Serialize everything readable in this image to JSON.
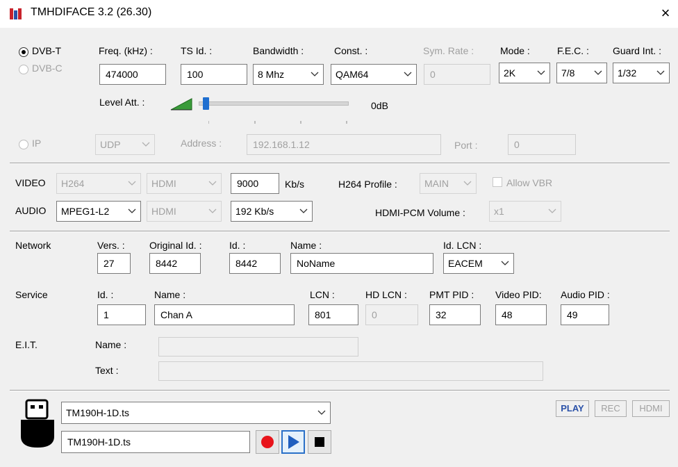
{
  "window": {
    "title": "TMHDIFACE 3.2 (26.30)",
    "close": "×"
  },
  "modulation": {
    "dvbt": "DVB-T",
    "dvbc": "DVB-C",
    "freq_label": "Freq. (kHz) :",
    "freq_value": "474000",
    "tsid_label": "TS Id. :",
    "tsid_value": "100",
    "bandwidth_label": "Bandwidth :",
    "bandwidth_value": "8 Mhz",
    "const_label": "Const. :",
    "const_value": "QAM64",
    "symrate_label": "Sym. Rate :",
    "symrate_value": "0",
    "mode_label": "Mode :",
    "mode_value": "2K",
    "fec_label": "F.E.C. :",
    "fec_value": "7/8",
    "guard_label": "Guard Int. :",
    "guard_value": "1/32",
    "level_label": "Level Att. :",
    "level_value": "0dB",
    "level_fraction": 0.0
  },
  "ip": {
    "label": "IP",
    "proto_value": "UDP",
    "address_label": "Address :",
    "address_value": "192.168.1.12",
    "port_label": "Port :",
    "port_value": "0"
  },
  "video": {
    "label": "VIDEO",
    "codec": "H264",
    "source": "HDMI",
    "bitrate": "9000",
    "unit": "Kb/s",
    "profile_label": "H264 Profile :",
    "profile_value": "MAIN",
    "vbr_label": "Allow VBR"
  },
  "audio": {
    "label": "AUDIO",
    "codec": "MPEG1-L2",
    "source": "HDMI",
    "bitrate": "192 Kb/s",
    "volume_label": "HDMI-PCM Volume :",
    "volume_value": "x1"
  },
  "network": {
    "label": "Network",
    "vers_label": "Vers. :",
    "vers_value": "27",
    "origid_label": "Original Id. :",
    "origid_value": "8442",
    "id_label": "Id. :",
    "id_value": "8442",
    "name_label": "Name :",
    "name_value": "NoName",
    "lcn_label": "Id. LCN :",
    "lcn_value": "EACEM"
  },
  "service": {
    "label": "Service",
    "id_label": "Id. :",
    "id_value": "1",
    "name_label": "Name :",
    "name_value": "Chan A",
    "lcn_label": "LCN :",
    "lcn_value": "801",
    "hdlcn_label": "HD LCN :",
    "hdlcn_value": "0",
    "pmt_label": "PMT PID :",
    "pmt_value": "32",
    "video_label": "Video PID:",
    "video_value": "48",
    "audio_label": "Audio PID :",
    "audio_value": "49"
  },
  "eit": {
    "label": "E.I.T.",
    "name_label": "Name :",
    "text_label": "Text :",
    "name_value": "",
    "text_value": ""
  },
  "player": {
    "file_select": "TM190H-1D.ts",
    "file_input": "TM190H-1D.ts",
    "play": "PLAY",
    "rec": "REC",
    "hdmi": "HDMI"
  },
  "colors": {
    "record": "#e8141b",
    "play": "#1f5fbf",
    "accent": "#2a51a8",
    "level": "#3a9b3a"
  }
}
